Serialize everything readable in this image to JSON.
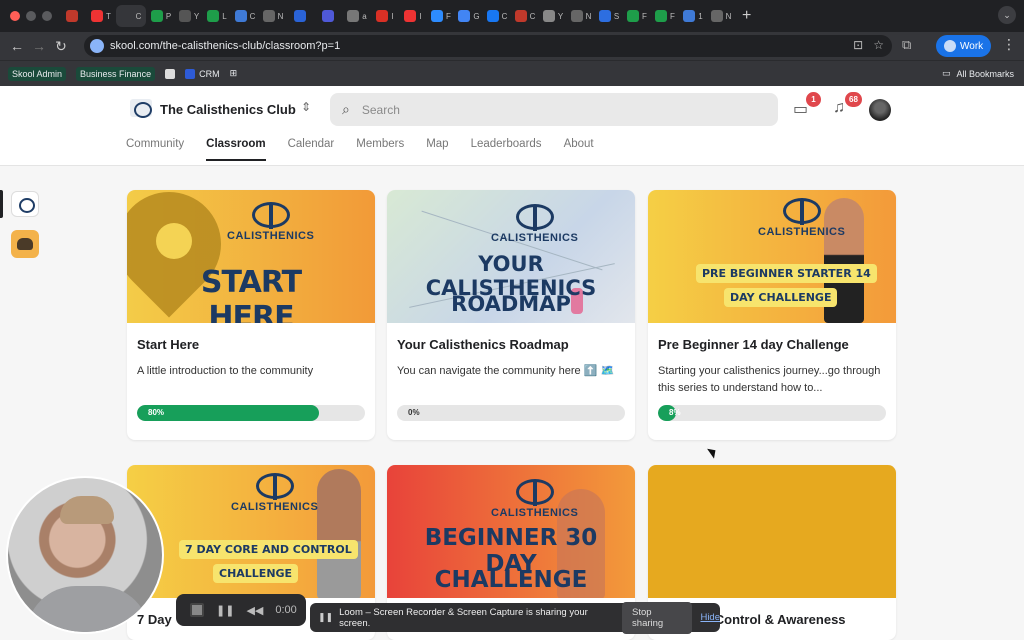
{
  "browser": {
    "tabs": [
      {
        "icon": "circle-icon",
        "color": "#c0392b",
        "text": ""
      },
      {
        "icon": "skool-icon",
        "color": "#e33",
        "text": "T"
      },
      {
        "icon": "tab-icon",
        "color": "#35363a",
        "text": "C"
      },
      {
        "icon": "plus-circle-icon",
        "color": "#1e9e4a",
        "text": "P"
      },
      {
        "icon": "skool-icon",
        "color": "#555",
        "text": "Y"
      },
      {
        "icon": "plus-circle-icon",
        "color": "#1e9e4a",
        "text": "L"
      },
      {
        "icon": "gear-icon",
        "color": "#3f7ad6",
        "text": "C"
      },
      {
        "icon": "github-icon",
        "color": "#666",
        "text": "N"
      },
      {
        "icon": "meta-icon",
        "color": "#2a63d6",
        "text": ""
      },
      {
        "icon": "bracket-icon",
        "color": "#4f59d8",
        "text": ""
      },
      {
        "icon": "globe-icon",
        "color": "#777",
        "text": "a"
      },
      {
        "icon": "gmail-icon",
        "color": "#d93025",
        "text": "I"
      },
      {
        "icon": "skool-icon",
        "color": "#e33",
        "text": "I"
      },
      {
        "icon": "zoom-icon",
        "color": "#2d8cff",
        "text": "F"
      },
      {
        "icon": "google-icon",
        "color": "#4285f4",
        "text": "G"
      },
      {
        "icon": "facebook-icon",
        "color": "#1877f2",
        "text": "C"
      },
      {
        "icon": "spider-icon",
        "color": "#c0392b",
        "text": "C"
      },
      {
        "icon": "bird-icon",
        "color": "#888",
        "text": "Y"
      },
      {
        "icon": "github-icon",
        "color": "#666",
        "text": "N"
      },
      {
        "icon": "stack-icon",
        "color": "#2d6ee0",
        "text": "S"
      },
      {
        "icon": "plus-circle-icon",
        "color": "#1e9e4a",
        "text": "F"
      },
      {
        "icon": "plus-circle-icon",
        "color": "#1e9e4a",
        "text": "F"
      },
      {
        "icon": "gear-icon",
        "color": "#3f7ad6",
        "text": "1"
      },
      {
        "icon": "github-icon",
        "color": "#666",
        "text": "N"
      }
    ],
    "active_tab_label": "C",
    "url": "skool.com/the-calisthenics-club/classroom?p=1",
    "profile_label": "Work",
    "bookmarks": [
      {
        "label": "Skool Admin",
        "color": "#000"
      },
      {
        "label": "Business Finance",
        "color": "#000"
      },
      {
        "label": "",
        "color": "#ddd"
      },
      {
        "label": "CRM",
        "color": "#2e5bd6"
      }
    ],
    "all_bookmarks_label": "All Bookmarks"
  },
  "header": {
    "group_name": "The Calisthenics Club",
    "search_placeholder": "Search",
    "chat_badge": "1",
    "notif_badge": "68",
    "nav_tabs": [
      "Community",
      "Classroom",
      "Calendar",
      "Members",
      "Map",
      "Leaderboards",
      "About"
    ],
    "active_tab": "Classroom"
  },
  "courses": [
    {
      "title": "Start Here",
      "description": "A little introduction to the community",
      "progress": 80,
      "progress_label": "80%",
      "cover_text": "START HERE",
      "cover_brand": "CALISTHENICS",
      "cover_colors": [
        "#f3cc48",
        "#f29a38"
      ]
    },
    {
      "title": "Your Calisthenics Roadmap",
      "description": "You can navigate the community here ⬆️ 🗺️",
      "progress": 0,
      "progress_label": "0%",
      "cover_text_1": "YOUR CALISTHENICS",
      "cover_text_2": "ROADMAP",
      "cover_brand": "CALISTHENICS",
      "cover_colors": [
        "#cfe3d2",
        "#c8d6e8"
      ]
    },
    {
      "title": "Pre Beginner 14 day Challenge",
      "description": "Starting your calisthenics journey...go through this series to understand how to...",
      "progress": 8,
      "progress_label": "8%",
      "cover_text_1": "PRE BEGINNER STARTER 14",
      "cover_text_2": "DAY CHALLENGE",
      "cover_brand": "CALISTHENICS",
      "cover_colors": [
        "#f5cf45",
        "#f39a3a"
      ]
    },
    {
      "title": "7 Day",
      "cover_text_1": "7 DAY CORE AND CONTROL",
      "cover_text_2": "CHALLENGE",
      "cover_brand": "CALISTHENICS",
      "cover_colors": [
        "#f5cf45",
        "#f39a3a"
      ]
    },
    {
      "title": "",
      "cover_text_1": "BEGINNER 30 DAY",
      "cover_text_2": "CHALLENGE",
      "cover_brand": "CALISTHENICS",
      "cover_colors": [
        "#e8433a",
        "#f39a3a"
      ]
    },
    {
      "title": "e - Control & Awareness",
      "cover_colors": [
        "#e6a91f",
        "#e6a91f"
      ]
    }
  ],
  "loom": {
    "timer": "0:00",
    "message": "Loom – Screen Recorder & Screen Capture is sharing your screen.",
    "stop_label": "Stop sharing",
    "hide_label": "Hide"
  }
}
